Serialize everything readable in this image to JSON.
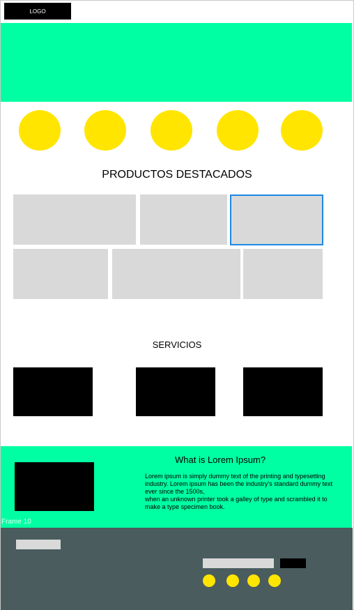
{
  "header": {
    "logo_text": "LOGO"
  },
  "categories": {
    "count": 5,
    "color": "#ffe500"
  },
  "products": {
    "title": "PRODUCTOS DESTACADOS"
  },
  "services": {
    "title": "SERVICIOS"
  },
  "about": {
    "title": "What is Lorem Ipsum?",
    "body": "Lorem ipsum is simply dummy text of the printing and typesetting industry.  Lorem ipsum has been the industry's standard dummy text ever since the 1500s,\n when an unknown printer took a galley of type and scrambled it to make a type specimen book."
  },
  "frame_label": "Frame 10",
  "colors": {
    "accent_green": "#00ffa3",
    "accent_yellow": "#ffe500",
    "placeholder_gray": "#d9d9d9",
    "footer_bg": "#4a5c5d",
    "selection_blue": "#1e88e5"
  }
}
